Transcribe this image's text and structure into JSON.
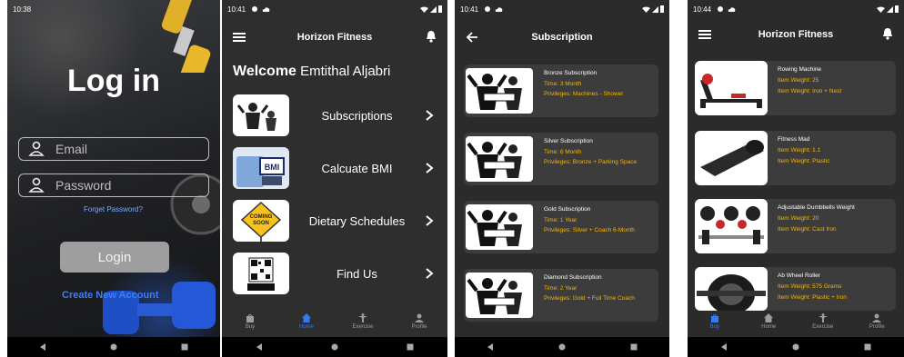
{
  "login": {
    "status_time": "10:38",
    "title": "Log in",
    "email_placeholder": "Email",
    "password_placeholder": "Password",
    "forgot": "Forget Password?",
    "login_button": "Login",
    "create_account": "Create New Account"
  },
  "menu": {
    "status_time": "10:41",
    "app_title": "Horizon Fitness",
    "welcome_word": "Welcome",
    "user_name": "Emtithal Aljabri",
    "items": [
      {
        "label": "Subscriptions",
        "icon": "bodybuilder-icon"
      },
      {
        "label": "Calcuate BMI",
        "icon": "bmi-scale-icon"
      },
      {
        "label": "Dietary Schedules",
        "icon": "coming-soon-sign-icon"
      },
      {
        "label": "Find Us",
        "icon": "qr-code-icon"
      }
    ],
    "tabs": [
      {
        "label": "Buy",
        "icon": "bag-icon",
        "active": false
      },
      {
        "label": "Home",
        "icon": "home-icon",
        "active": true
      },
      {
        "label": "Exercise",
        "icon": "figure-icon",
        "active": false
      },
      {
        "label": "Profile",
        "icon": "person-icon",
        "active": false
      }
    ]
  },
  "subs": {
    "status_time": "10:41",
    "title": "Subscription",
    "items": [
      {
        "name": "Bronze Subscription",
        "time": "Time: 3 Month",
        "privileges": "Privileges: Machines - Shower"
      },
      {
        "name": "Silver Subscription",
        "time": "Time: 6 Month",
        "privileges": "Privileges: Bronze + Parking Space"
      },
      {
        "name": "Gold Subscription",
        "time": "Time: 1 Year",
        "privileges": "Privileges: Silver + Coach 6-Month"
      },
      {
        "name": "Diamond Subscription",
        "time": "Time: 2 Year",
        "privileges": "Privileges: Gold + Full Time Coach"
      }
    ]
  },
  "buy": {
    "status_time": "10:44",
    "app_title": "Horizon Fitness",
    "items": [
      {
        "name": "Rowing Machine",
        "weight": "Item Weight: 25",
        "material": "Item Weight: Iron + Nest"
      },
      {
        "name": "Fitness Mad",
        "weight": "Item Weight: 1.1",
        "material": "Item Weight: Plastic"
      },
      {
        "name": "Adjustable Dumbbells Weight",
        "weight": "Item Weight: 20",
        "material": "Item Weight: Cast Iron"
      },
      {
        "name": "Ab Wheel Roller",
        "weight": "Item Weight: 575 Grams",
        "material": "Item Weight: Plastic + Iron"
      }
    ],
    "tabs": [
      {
        "label": "Buy",
        "active": true
      },
      {
        "label": "Home",
        "active": false
      },
      {
        "label": "Exercise",
        "active": false
      },
      {
        "label": "Profile",
        "active": false
      }
    ]
  },
  "colors": {
    "accent_blue": "#2f7cf6",
    "gold_text": "#f5b400",
    "card_bg": "#3c3c3c"
  }
}
